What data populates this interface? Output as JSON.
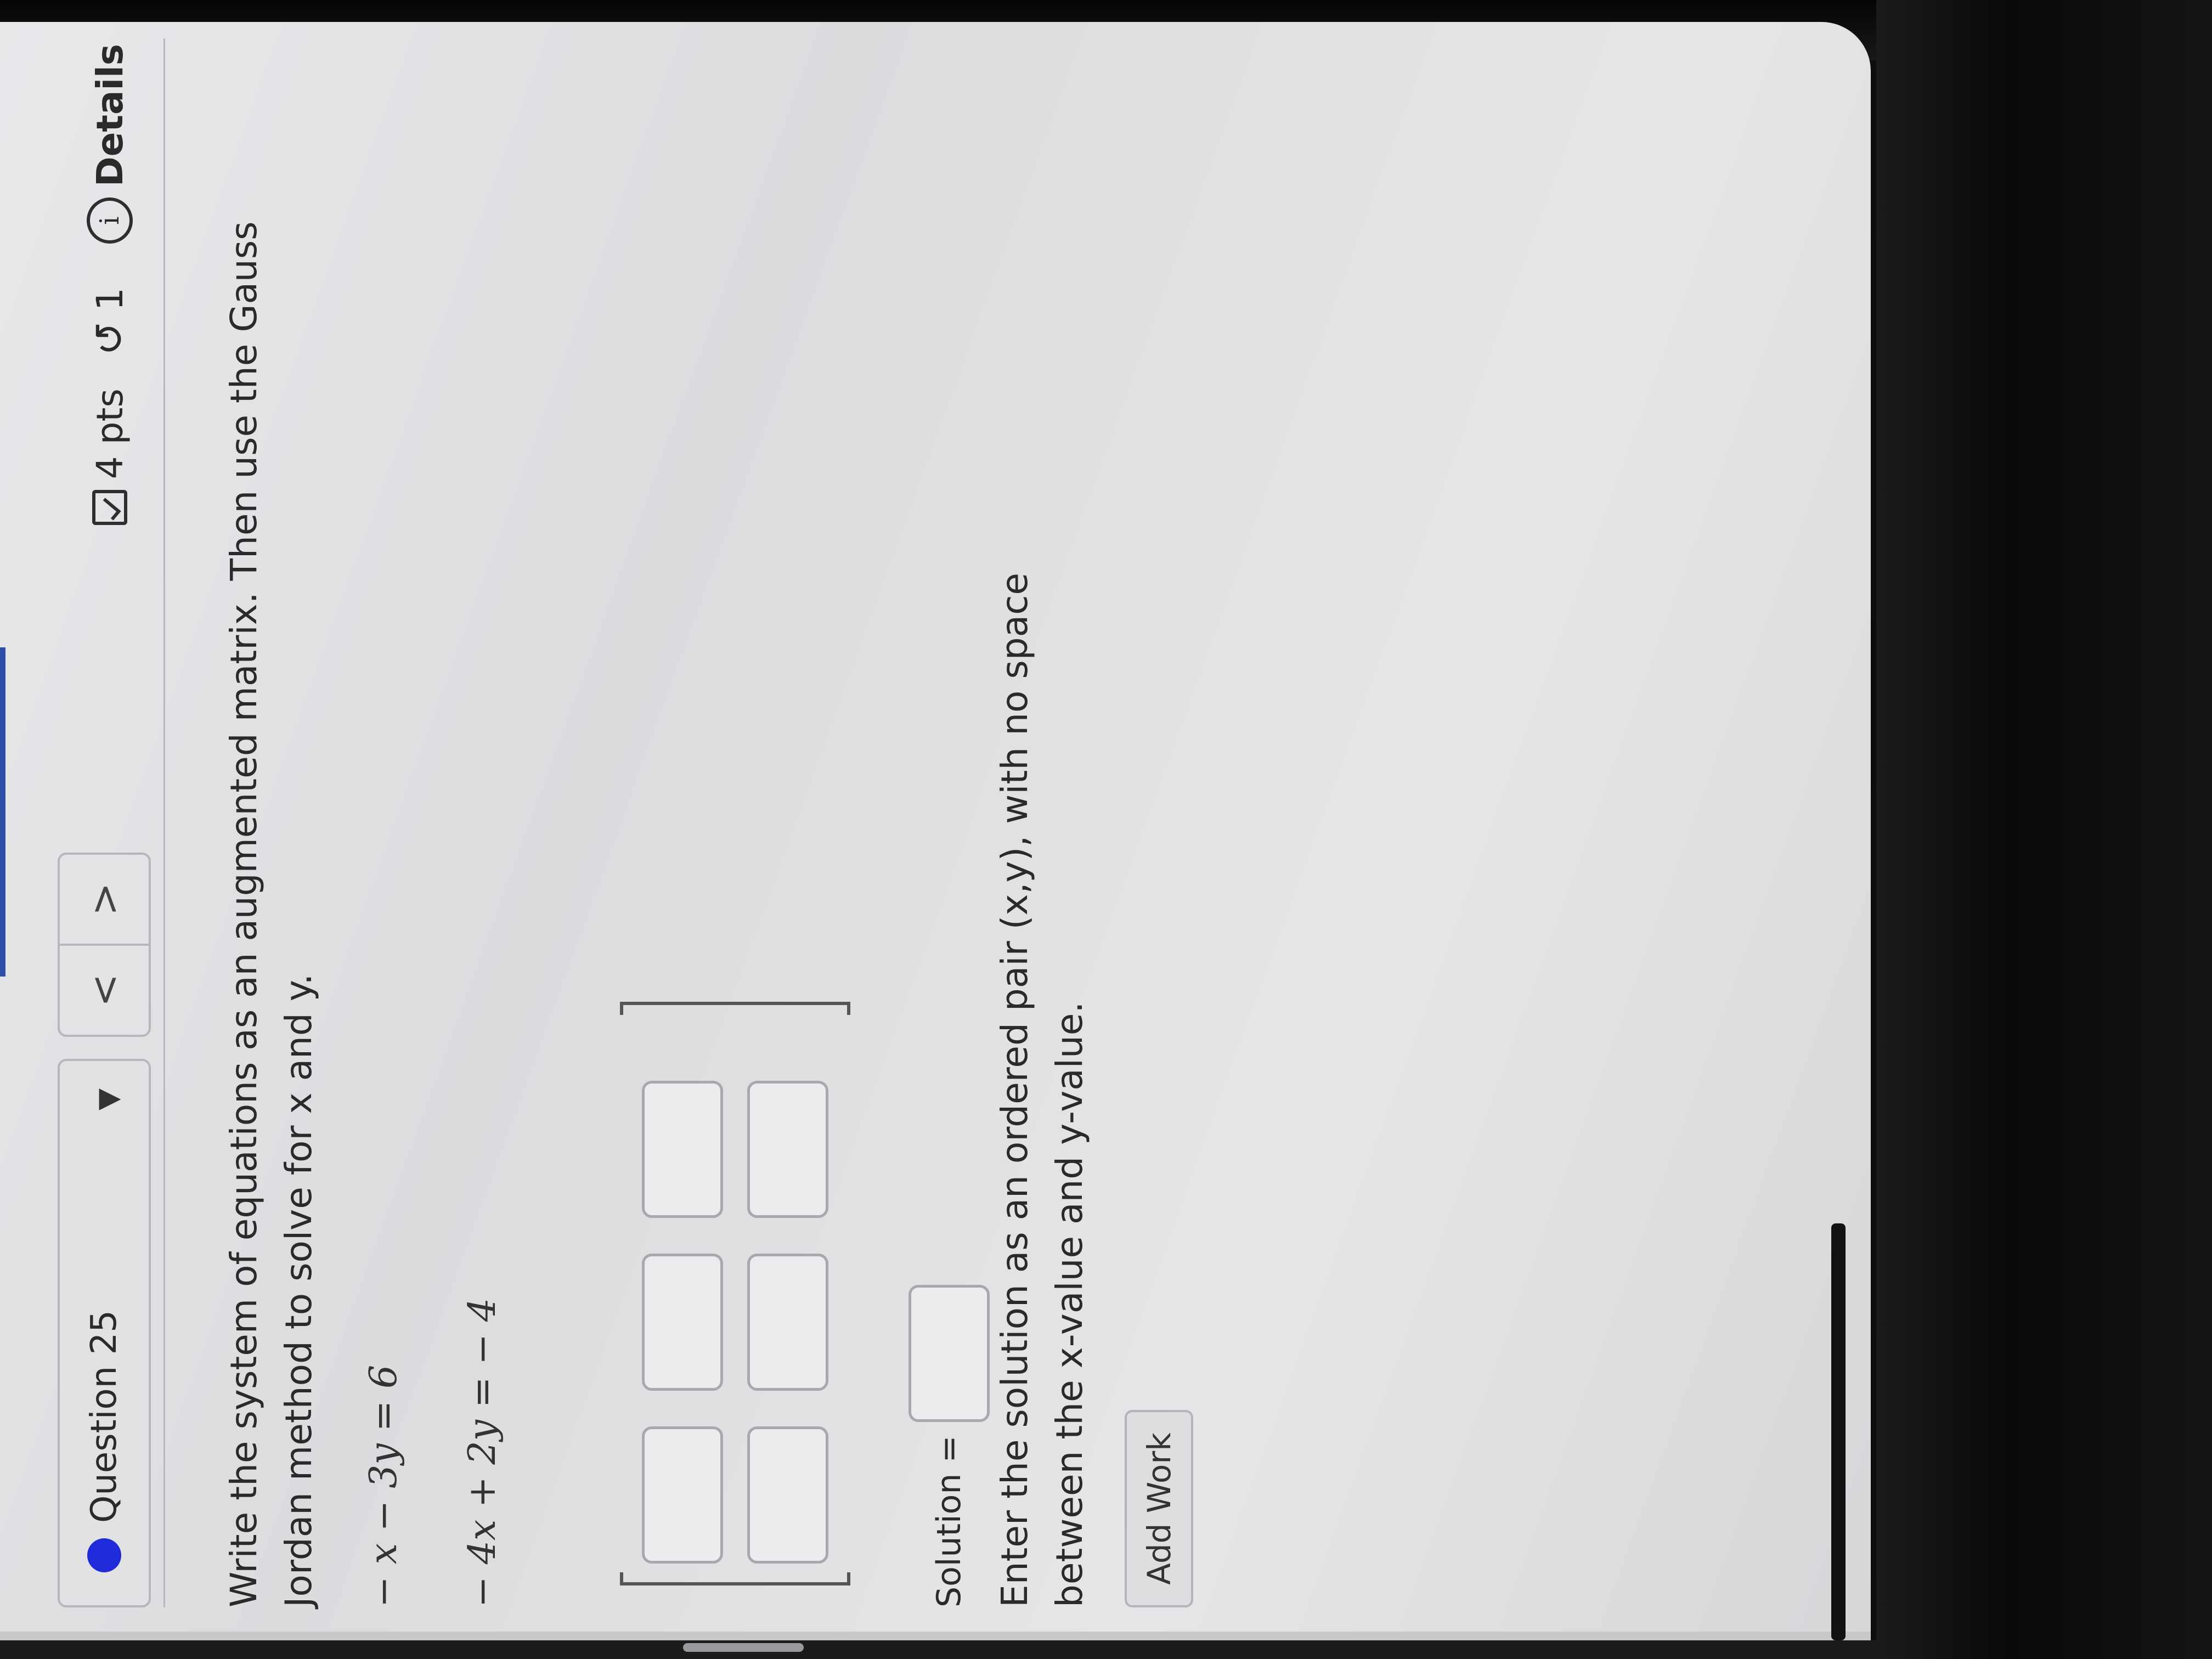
{
  "header": {
    "question_label": "Question 25",
    "dropdown_icon": "triangle-down-icon",
    "prev_icon": "chevron-left-icon",
    "next_icon": "chevron-right-icon",
    "points": "4 pts",
    "retries": "1",
    "details_label": "Details"
  },
  "question": {
    "instructions": "Write the system of equations as an augmented matrix. Then use the Gauss Jordan method to solve for x and y.",
    "equations": [
      "− x − 3y = 6",
      "− 4x + 2y = − 4"
    ]
  },
  "solution": {
    "label": "Solution =",
    "hint": "Enter the solution as an ordered pair (x,y), with no space between the x-value and y-value."
  },
  "buttons": {
    "add_work": "Add Work"
  },
  "colors": {
    "question_dot": "#1f2bd8",
    "page_background": "#e4e4e7"
  }
}
